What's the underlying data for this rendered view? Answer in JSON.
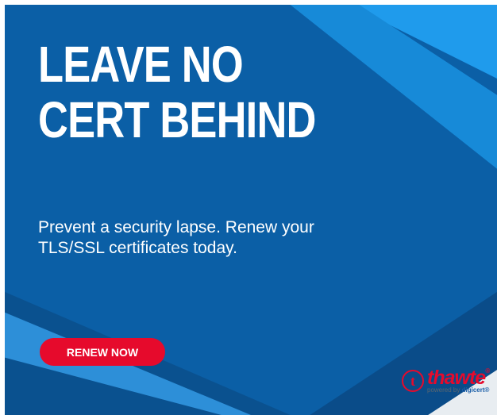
{
  "headline": {
    "line1": "LEAVE NO",
    "line2": "CERT BEHIND"
  },
  "subhead": "Prevent a security lapse. Renew your TLS/SSL certificates today.",
  "cta": {
    "label": "RENEW NOW"
  },
  "logo": {
    "mark": "t",
    "wordmark": "thawte",
    "trademark": "®",
    "powered_by": "powered by",
    "brand": "digicert",
    "brand_mark": "®"
  },
  "colors": {
    "primary_blue": "#0b5fa6",
    "light_blue": "#1f9bec",
    "accent_red": "#e60a2c",
    "white": "#ffffff"
  }
}
